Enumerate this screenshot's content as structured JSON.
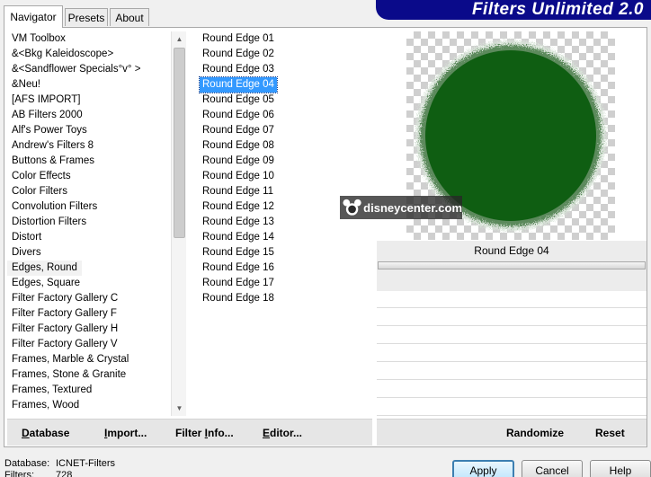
{
  "tabs": [
    {
      "label": "Navigator"
    },
    {
      "label": "Presets"
    },
    {
      "label": "About"
    }
  ],
  "banner": {
    "title": "Filters Unlimited 2.0",
    "color": "#0a0a8a"
  },
  "categories": {
    "selected": "Edges, Round",
    "items": [
      "VM Toolbox",
      "&<Bkg Kaleidoscope>",
      "&<Sandflower Specials°v° >",
      "&Neu!",
      "[AFS IMPORT]",
      "AB Filters 2000",
      "Alf's Power Toys",
      "Andrew's Filters 8",
      "Buttons & Frames",
      "Color Effects",
      "Color Filters",
      "Convolution Filters",
      "Distortion Filters",
      "Distort",
      "Divers",
      "Edges, Round",
      "Edges, Square",
      "Filter Factory Gallery C",
      "Filter Factory Gallery F",
      "Filter Factory Gallery H",
      "Filter Factory Gallery V",
      "Frames, Marble & Crystal",
      "Frames, Stone & Granite",
      "Frames, Textured",
      "Frames, Wood"
    ]
  },
  "filters": {
    "selected": "Round Edge 04",
    "items": [
      "Round Edge 01",
      "Round Edge 02",
      "Round Edge 03",
      "Round Edge 04",
      "Round Edge 05",
      "Round Edge 06",
      "Round Edge 07",
      "Round Edge 08",
      "Round Edge 09",
      "Round Edge 10",
      "Round Edge 11",
      "Round Edge 12",
      "Round Edge 13",
      "Round Edge 14",
      "Round Edge 15",
      "Round Edge 16",
      "Round Edge 17",
      "Round Edge 18"
    ]
  },
  "preview": {
    "circle_color": "#0f5e12",
    "watermark_text": "disneycenter.com",
    "filter_name": "Round Edge 04"
  },
  "left_toolbar": {
    "database": {
      "accel": "D",
      "rest": "atabase"
    },
    "import": {
      "accel": "I",
      "rest": "mport..."
    },
    "filter_info": {
      "pre": "Filter ",
      "accel": "I",
      "rest": "nfo..."
    },
    "editor": {
      "accel": "E",
      "rest": "ditor..."
    }
  },
  "right_toolbar": {
    "randomize": "Randomize",
    "reset": "Reset"
  },
  "status": {
    "database_label": "Database:",
    "database_value": "ICNET-Filters",
    "filters_label": "Filters:",
    "filters_value": "728"
  },
  "dialog_buttons": {
    "apply": "Apply",
    "cancel": "Cancel",
    "help": "Help"
  }
}
